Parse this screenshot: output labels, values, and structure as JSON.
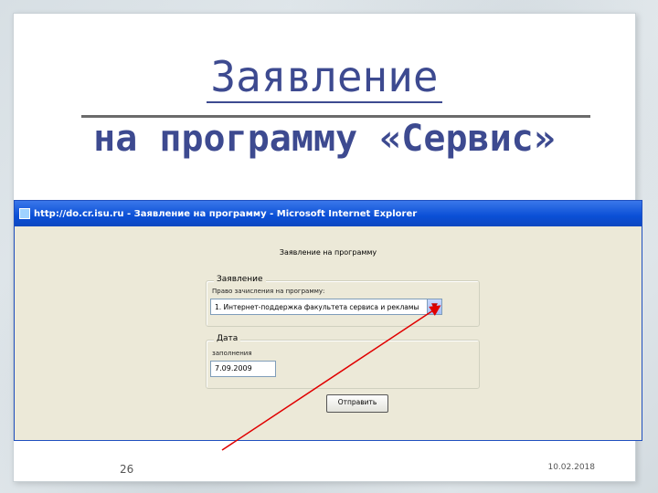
{
  "slide": {
    "title_line1": "Заявление",
    "title_line2": "на программу «Сервис»",
    "page_number": "26",
    "date": "10.02.2018"
  },
  "browser": {
    "window_title": "http://do.cr.isu.ru - Заявление на программу - Microsoft Internet Explorer"
  },
  "form": {
    "heading": "Заявление на программу",
    "group1_legend": "Заявление",
    "program_label": "Право зачисления на программу:",
    "program_selected": "1. Интернет-поддержка факультета сервиса и рекламы",
    "group2_legend": "Дата",
    "date_label": "заполнения",
    "date_value": "7.09.2009",
    "submit_label": "Отправить"
  },
  "colors": {
    "title": "#3d4a90",
    "ie_titlebar": "#0a4fd6",
    "arrow": "#e00000"
  }
}
